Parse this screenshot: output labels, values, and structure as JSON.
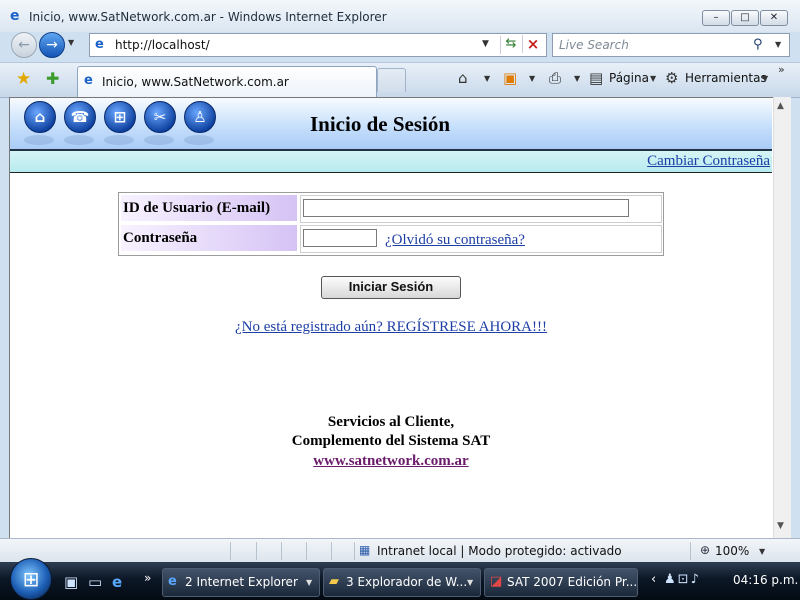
{
  "window": {
    "title": "Inicio, www.SatNetwork.com.ar - Windows Internet Explorer",
    "minimize_glyph": "–",
    "maximize_glyph": "□",
    "close_glyph": "✕"
  },
  "address_bar": {
    "url": "http://localhost/"
  },
  "search": {
    "placeholder": "Live Search"
  },
  "tab": {
    "label": "Inicio, www.SatNetwork.com.ar"
  },
  "toolbar": {
    "page_label": "Página",
    "tools_label": "Herramientas"
  },
  "page": {
    "title": "Inicio de Sesión",
    "change_password_link": "Cambiar Contraseña",
    "nav_icons": [
      "home-icon",
      "phone-icon",
      "cart-icon",
      "tools-icon",
      "user-icon"
    ],
    "form": {
      "user_id_label": "ID de Usuario (E-mail)",
      "user_id_value": "",
      "password_label": "Contraseña",
      "password_value": "",
      "forgot_link": "¿Olvidó su contraseña?"
    },
    "login_button": "Iniciar Sesión",
    "register_link": "¿No está registrado aún? REGÍSTRESE AHORA!!!",
    "footer": {
      "line1": "Servicios al Cliente,",
      "line2": "Complemento del Sistema SAT",
      "url": "www.satnetwork.com.ar"
    }
  },
  "status_bar": {
    "zone": "Intranet local | Modo protegido: activado",
    "zoom": "100%"
  },
  "taskbar": {
    "items": [
      {
        "label": "2 Internet Explorer",
        "icon": "ie-icon"
      },
      {
        "label": "3 Explorador de W...",
        "icon": "folder-icon"
      },
      {
        "label": "SAT 2007 Edición Pr...",
        "icon": "app-icon"
      }
    ],
    "clock": "04:16 p.m."
  },
  "colors": {
    "link": "#1c3ea5",
    "visited_link": "#6a1b6a",
    "label_cell": "#d5c3f5",
    "header_gradient": "#a9ccf6",
    "subbar": "#b7ebee"
  }
}
